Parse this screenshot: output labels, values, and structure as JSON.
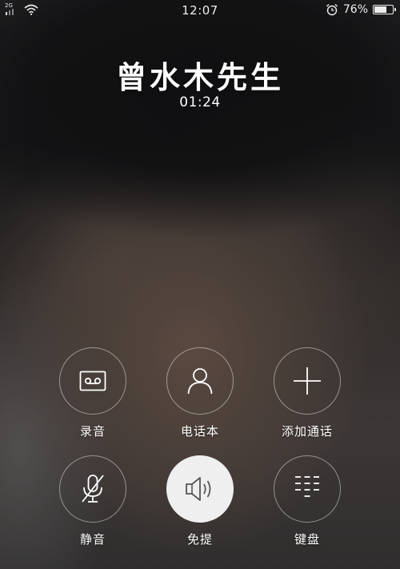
{
  "status_bar": {
    "network": "2G",
    "time": "12:07",
    "battery_percent": "76%",
    "battery_level": 0.76
  },
  "call": {
    "caller_name": "曾水木先生",
    "duration": "01:24"
  },
  "actions": [
    {
      "id": "record",
      "label": "录音",
      "icon": "cassette-tape-icon",
      "active": false
    },
    {
      "id": "contacts",
      "label": "电话本",
      "icon": "person-icon",
      "active": false
    },
    {
      "id": "add_call",
      "label": "添加通话",
      "icon": "plus-icon",
      "active": false
    },
    {
      "id": "mute",
      "label": "静音",
      "icon": "microphone-muted-icon",
      "active": false
    },
    {
      "id": "speaker",
      "label": "免提",
      "icon": "speaker-icon",
      "active": true
    },
    {
      "id": "keypad",
      "label": "键盘",
      "icon": "dialpad-icon",
      "active": false
    }
  ],
  "colors": {
    "active_button_bg": "#efefef",
    "active_icon": "#555555",
    "text": "#ffffff"
  }
}
